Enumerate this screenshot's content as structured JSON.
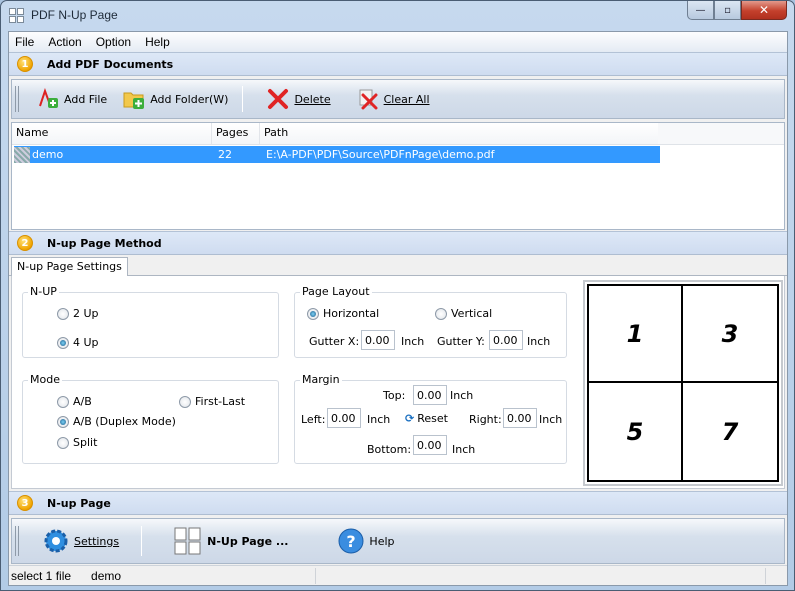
{
  "window": {
    "title": "PDF N-Up Page",
    "controls": {
      "minimize": "—",
      "maximize": "▫",
      "close": "✕"
    }
  },
  "menu": [
    "File",
    "Action",
    "Option",
    "Help"
  ],
  "section1": {
    "number": "1",
    "title": "Add PDF Documents"
  },
  "toolbar1": {
    "add_file": "Add File",
    "add_folder": "Add Folder(W)",
    "delete": "Delete",
    "clear_all": "Clear All"
  },
  "filelist": {
    "columns": [
      "Name",
      "Pages",
      "Path"
    ],
    "rows": [
      {
        "name": "demo",
        "pages": "22",
        "path": "E:\\A-PDF\\PDF\\Source\\PDFnPage\\demo.pdf",
        "selected": true
      }
    ]
  },
  "section2": {
    "number": "2",
    "title": "N-up Page  Method"
  },
  "tab": "N-up Page Settings",
  "nup": {
    "label": "N-UP",
    "options": [
      "2 Up",
      "4 Up"
    ],
    "selected": "4 Up"
  },
  "layout": {
    "label": "Page Layout",
    "options": [
      "Horizontal",
      "Vertical"
    ],
    "selected": "Horizontal",
    "gutter_x_label": "Gutter X:",
    "gutter_x": "0.00",
    "gutter_y_label": "Gutter Y:",
    "gutter_y": "0.00",
    "unit": "Inch"
  },
  "mode": {
    "label": "Mode",
    "options": [
      "A/B",
      "First-Last",
      "A/B (Duplex Mode)",
      "Split"
    ],
    "selected": "A/B (Duplex Mode)"
  },
  "margin": {
    "label": "Margin",
    "top_label": "Top:",
    "top": "0.00",
    "left_label": "Left:",
    "left": "0.00",
    "right_label": "Right:",
    "right": "0.00",
    "bottom_label": "Bottom:",
    "bottom": "0.00",
    "unit": "Inch",
    "reset": "Reset"
  },
  "preview": {
    "pages": [
      "1",
      "3",
      "5",
      "7"
    ]
  },
  "section3": {
    "number": "3",
    "title": "N-up Page"
  },
  "toolbar3": {
    "settings": "Settings",
    "nup_page": "N-Up Page ...",
    "help": "Help"
  },
  "status": {
    "left": "select 1 file",
    "file": "demo"
  }
}
